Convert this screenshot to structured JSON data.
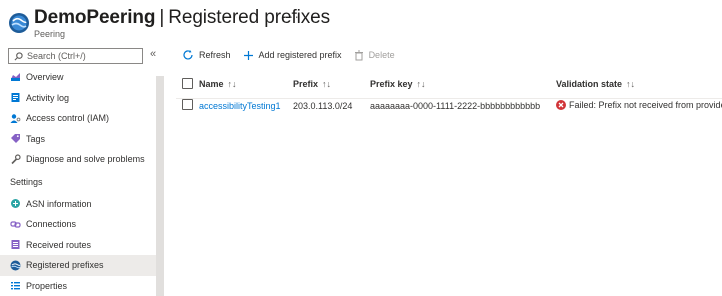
{
  "header": {
    "resource_name": "DemoPeering",
    "separator": "|",
    "page_title": "Registered prefixes",
    "resource_type": "Peering",
    "more_label": "···"
  },
  "sidebar": {
    "search_placeholder": "Search (Ctrl+/)",
    "collapse_label": "«",
    "items": [
      {
        "label": "Overview",
        "icon": "overview-icon"
      },
      {
        "label": "Activity log",
        "icon": "activity-log-icon"
      },
      {
        "label": "Access control (IAM)",
        "icon": "access-control-icon"
      },
      {
        "label": "Tags",
        "icon": "tag-icon"
      },
      {
        "label": "Diagnose and solve problems",
        "icon": "wrench-icon"
      }
    ],
    "section_label": "Settings",
    "settings_items": [
      {
        "label": "ASN information",
        "icon": "asn-icon"
      },
      {
        "label": "Connections",
        "icon": "connections-icon"
      },
      {
        "label": "Received routes",
        "icon": "received-routes-icon"
      },
      {
        "label": "Registered prefixes",
        "icon": "peering-icon",
        "selected": true
      },
      {
        "label": "Properties",
        "icon": "properties-icon"
      }
    ]
  },
  "toolbar": {
    "refresh_label": "Refresh",
    "add_label": "Add registered prefix",
    "delete_label": "Delete"
  },
  "table": {
    "columns": [
      "Name",
      "Prefix",
      "Prefix key",
      "Validation state"
    ],
    "sort_glyph": "↑↓",
    "rows": [
      {
        "name": "accessibilityTesting1",
        "prefix": "203.0.113.0/24",
        "prefix_key": "aaaaaaaa-0000-1111-2222-bbbbbbbbbbbb",
        "validation_state": "Failed: Prefix not received from provider"
      }
    ]
  },
  "colors": {
    "accent": "#0078d4",
    "error": "#d13438",
    "selected_bg": "#edebe9"
  }
}
